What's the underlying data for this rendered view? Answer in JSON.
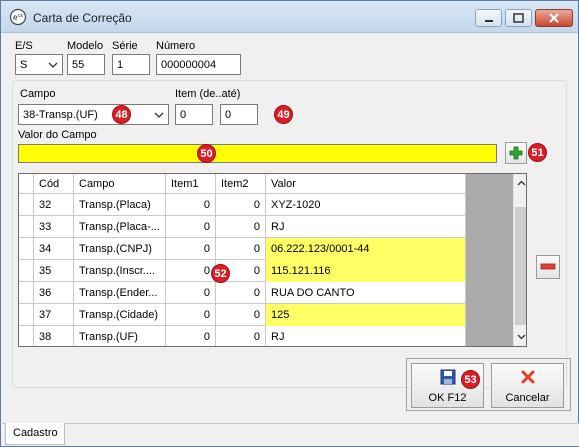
{
  "window": {
    "title": "Carta de Correção"
  },
  "header_fields": {
    "es_label": "E/S",
    "es_value": "S",
    "modelo_label": "Modelo",
    "modelo_value": "55",
    "serie_label": "Série",
    "serie_value": "1",
    "numero_label": "Número",
    "numero_value": "000000004"
  },
  "campo": {
    "label": "Campo",
    "value": "38-Transp.(UF)"
  },
  "item": {
    "label": "Item (de..até)",
    "from_value": "0",
    "to_value": "0"
  },
  "valor": {
    "label": "Valor do Campo",
    "value": ""
  },
  "badges": {
    "b48": "48",
    "b49": "49",
    "b50": "50",
    "b51": "51",
    "b52": "52",
    "b53": "53"
  },
  "grid": {
    "columns": [
      "Cód",
      "Campo",
      "Item1",
      "Item2",
      "Valor"
    ],
    "rows": [
      {
        "cod": "32",
        "campo": "Transp.(Placa)",
        "item1": "0",
        "item2": "0",
        "valor": "XYZ-1020",
        "highlight": false
      },
      {
        "cod": "33",
        "campo": "Transp.(Placa-...",
        "item1": "0",
        "item2": "0",
        "valor": "RJ",
        "highlight": false
      },
      {
        "cod": "34",
        "campo": "Transp.(CNPJ)",
        "item1": "0",
        "item2": "0",
        "valor": "06.222.123/0001-44",
        "highlight": true
      },
      {
        "cod": "35",
        "campo": "Transp.(Inscr....",
        "item1": "0",
        "item2": "0",
        "valor": "115.121.116",
        "highlight": true
      },
      {
        "cod": "36",
        "campo": "Transp.(Ender...",
        "item1": "0",
        "item2": "0",
        "valor": "RUA DO CANTO",
        "highlight": false
      },
      {
        "cod": "37",
        "campo": "Transp.(Cidade)",
        "item1": "0",
        "item2": "0",
        "valor": "125",
        "highlight": true
      },
      {
        "cod": "38",
        "campo": "Transp.(UF)",
        "item1": "0",
        "item2": "0",
        "valor": "RJ",
        "highlight": false
      }
    ]
  },
  "buttons": {
    "ok_label": "OK  F12",
    "cancel_label": "Cancelar"
  },
  "tabs": {
    "active": "Cadastro"
  },
  "colors": {
    "highlight": "#ffff00",
    "badge": "#d81f26"
  }
}
